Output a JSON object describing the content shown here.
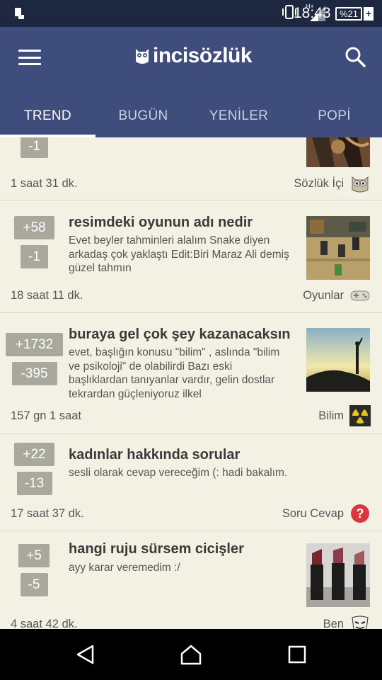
{
  "status_bar": {
    "time": "18:43",
    "battery": "%21",
    "network": "H+"
  },
  "app": {
    "logo_text": "incisözlük"
  },
  "tabs": [
    {
      "label": "TREND",
      "active": true
    },
    {
      "label": "BUGÜN",
      "active": false
    },
    {
      "label": "YENİLER",
      "active": false
    },
    {
      "label": "POPİ",
      "active": false
    }
  ],
  "entries": [
    {
      "title": "",
      "excerpt": "",
      "up": "",
      "down": "-1",
      "time": "1 saat 31 dk.",
      "category": "Sözlük İçi",
      "category_icon": "owl-icon"
    },
    {
      "title": "resimdeki oyunun adı nedir",
      "excerpt": "Evet beyler tahminleri alalım Snake diyen arkadaş çok yaklaştı Edit:Biri Maraz Ali demiş güzel tahmın",
      "up": "+58",
      "down": "-1",
      "time": "18 saat 11 dk.",
      "category": "Oyunlar",
      "category_icon": "gamepad-icon"
    },
    {
      "title": "buraya gel çok şey kazanacaksın",
      "excerpt": "evet, başlığın konusu \"bilim\" , aslında \"bilim ve psikoloji\" de olabilirdi Bazı eski başlıklardan tanıyanlar vardır, gelin dostlar tekrardan güçleniyoruz ilkel",
      "up": "+1732",
      "down": "-395",
      "time": "157 gn 1 saat",
      "category": "Bilim",
      "category_icon": "radiation-icon"
    },
    {
      "title": "kadınlar hakkında sorular",
      "excerpt": "sesli olarak cevap vereceğim (: hadi bakalım.",
      "up": "+22",
      "down": "-13",
      "time": "17 saat 37 dk.",
      "category": "Soru Cevap",
      "category_icon": "question-icon"
    },
    {
      "title": "hangi ruju sürsem cicişler",
      "excerpt": "ayy karar veremedim :/",
      "up": "+5",
      "down": "-5",
      "time": "4 saat 42 dk.",
      "category": "Ben",
      "category_icon": "mask-icon"
    }
  ],
  "colors": {
    "appbar": "#3e4d7b",
    "statusbar": "#1e2740",
    "background": "#f3f0e4",
    "vote_badge": "#a9a89d"
  }
}
